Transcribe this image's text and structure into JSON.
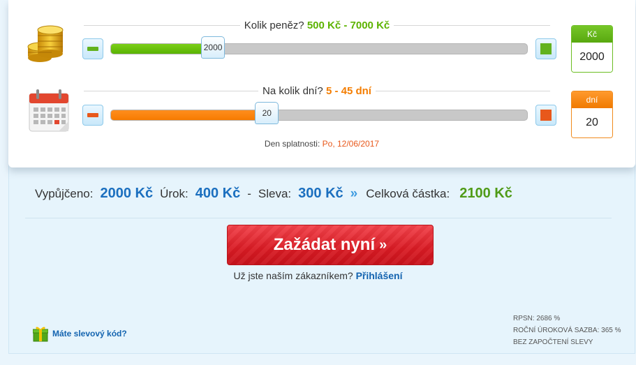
{
  "amount": {
    "title_prefix": "Kolik peněz?",
    "title_range": "500 Kč - 7000 Kč",
    "handle_value": "2000",
    "unit": "Kč",
    "input_value": "2000",
    "fill_fraction": 0.246,
    "icon": "coins-icon"
  },
  "days": {
    "title_prefix": "Na kolik dní?",
    "title_range": "5 - 45 dní",
    "handle_value": "20",
    "unit": "dní",
    "input_value": "20",
    "fill_fraction": 0.375,
    "icon": "calendar-icon"
  },
  "due": {
    "label": "Den splatnosti:",
    "date": "Po, 12/06/2017"
  },
  "summary": {
    "borrowed_label": "Vypůjčeno:",
    "borrowed_value": "2000 Kč",
    "interest_label": "Úrok:",
    "interest_value": "400 Kč",
    "minus": "-",
    "discount_label": "Sleva:",
    "discount_value": "300 Kč",
    "arrow": "»",
    "total_label": "Celková částka:",
    "total_value": "2100 Kč"
  },
  "cta": {
    "label": "Zažádat nyní",
    "raquo": "»"
  },
  "login": {
    "question": "Už jste naším zákazníkem?",
    "link": "Přihlášení"
  },
  "promo": {
    "label": "Máte slevový kód?",
    "icon": "gift-icon"
  },
  "rates": {
    "rpsn": "RPSN: 2686 %",
    "annual": "ROČNÍ ÚROKOVÁ SAZBA: 365 %",
    "note": "BEZ ZAPOČTENÍ SLEVY"
  },
  "colors": {
    "green": "#5ab303",
    "orange": "#f77b00",
    "blue": "#1b6fbf",
    "red": "#d91b24"
  }
}
